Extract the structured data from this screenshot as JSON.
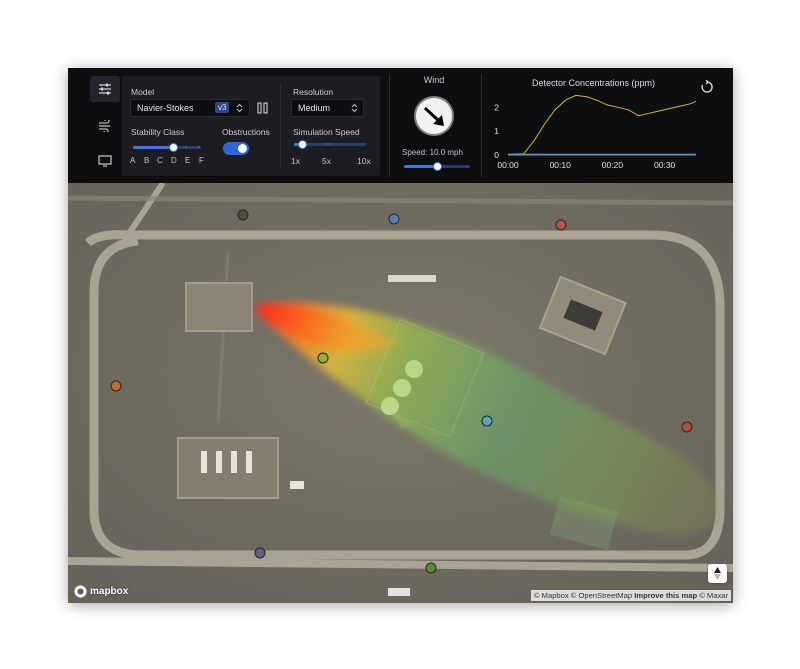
{
  "model_panel": {
    "model_label": "Model",
    "model_value": "Navier-Stokes",
    "model_version": "v3",
    "stability_label": "Stability Class",
    "stability_ticks": [
      "A",
      "B",
      "C",
      "D",
      "E",
      "F"
    ],
    "stability_value": "D",
    "obstructions_label": "Obstructions",
    "obstructions_on": true,
    "resolution_label": "Resolution",
    "resolution_value": "Medium",
    "sim_speed_label": "Simulation Speed",
    "sim_speed_ticks": [
      "1x",
      "5x",
      "10x"
    ],
    "sim_speed_fraction": 0.08
  },
  "wind": {
    "title": "Wind",
    "speed_text": "Speed: 10.0 mph",
    "speed_fraction": 0.5,
    "direction_icon": "arrow-down-right-icon"
  },
  "detector_chart": {
    "title": "Detector Concentrations (ppm)",
    "reload_icon": "refresh-icon"
  },
  "chart_data": {
    "type": "line",
    "title": "Detector Concentrations (ppm)",
    "x_ticks": [
      "00:00",
      "00:10",
      "00:20",
      "00:30"
    ],
    "y_ticks": [
      "0",
      "1",
      "2"
    ],
    "xlim": [
      0,
      36
    ],
    "ylim": [
      0,
      2.6
    ],
    "series": [
      {
        "color": "#d5b24a",
        "x": [
          0,
          3,
          5,
          7,
          9,
          11,
          13,
          15,
          17,
          19,
          21,
          23,
          25,
          27,
          29,
          31,
          33,
          35,
          36
        ],
        "y": [
          0.02,
          0.05,
          0.6,
          1.3,
          1.9,
          2.3,
          2.5,
          2.45,
          2.3,
          2.1,
          2.0,
          1.9,
          1.65,
          1.75,
          1.85,
          1.95,
          2.05,
          2.15,
          2.25
        ]
      },
      {
        "color": "#4fa3c8",
        "x": [
          0,
          36
        ],
        "y": [
          0.03,
          0.03
        ]
      },
      {
        "color": "#6c8fb3",
        "x": [
          0,
          36
        ],
        "y": [
          0.0,
          0.0
        ]
      }
    ]
  },
  "map": {
    "attribution_prefix": "© Mapbox © OpenStreetMap ",
    "attribution_improve": "Improve this map",
    "attribution_suffix": " © Maxar",
    "logo_text": "mapbox",
    "compass_icon": "north-arrow-icon"
  }
}
